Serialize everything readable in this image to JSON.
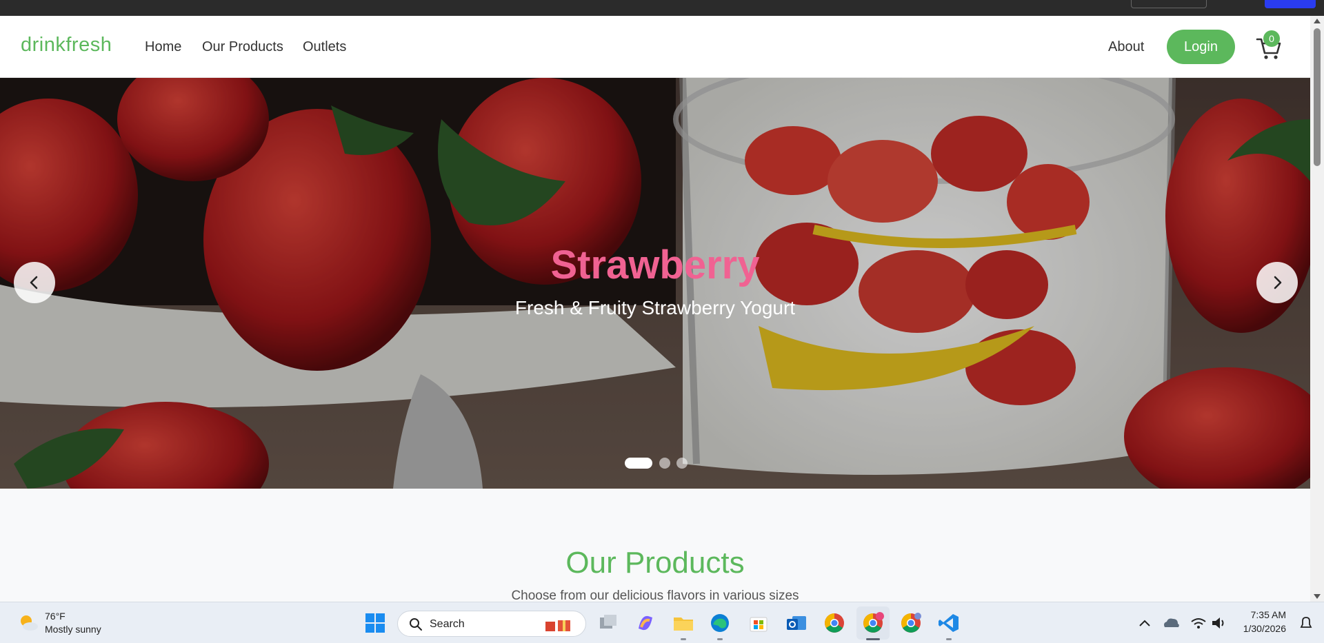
{
  "navbar": {
    "brand": "drinkfresh",
    "links": [
      "Home",
      "Our Products",
      "Outlets"
    ],
    "about": "About",
    "login": "Login",
    "cart_count": "0"
  },
  "hero": {
    "title": "Strawberry",
    "subtitle": "Fresh & Fruity Strawberry Yogurt",
    "slide_count": 3,
    "active_slide": 1
  },
  "products": {
    "title": "Our Products",
    "subtitle": "Choose from our delicious flavors in various sizes"
  },
  "taskbar": {
    "weather_temp": "76°F",
    "weather_desc": "Mostly sunny",
    "search_placeholder": "Search",
    "time": "7:35 AM",
    "date": "1/30/2026"
  },
  "colors": {
    "brand_green": "#5cb85c",
    "hero_title_pink": "#f06292"
  }
}
